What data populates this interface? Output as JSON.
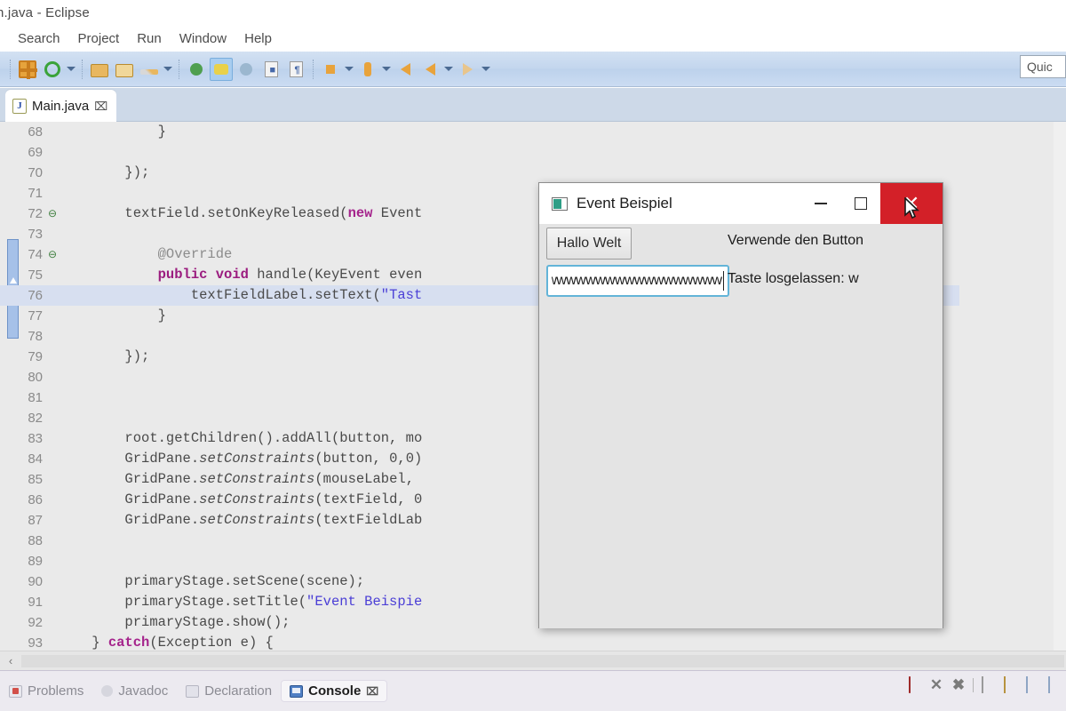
{
  "window": {
    "title": "n.java - Eclipse"
  },
  "menu": {
    "items": [
      "Search",
      "Project",
      "Run",
      "Window",
      "Help"
    ]
  },
  "toolbar": {
    "quick_access_placeholder": "Quick Access",
    "quick_access_value": "Quic"
  },
  "editor_tab": {
    "label": "Main.java",
    "icon": "J",
    "close": "⌧"
  },
  "code": {
    "cut_line": "",
    "lines": [
      {
        "n": "68",
        "fold": false,
        "hl": false,
        "segments": [
          {
            "t": "            }",
            "c": "pl"
          }
        ]
      },
      {
        "n": "69",
        "fold": false,
        "hl": false,
        "segments": [
          {
            "t": "",
            "c": "pl"
          }
        ]
      },
      {
        "n": "70",
        "fold": false,
        "hl": false,
        "segments": [
          {
            "t": "        });",
            "c": "pl"
          }
        ]
      },
      {
        "n": "71",
        "fold": false,
        "hl": false,
        "segments": [
          {
            "t": "",
            "c": "pl"
          }
        ]
      },
      {
        "n": "72",
        "fold": true,
        "hl": false,
        "segments": [
          {
            "t": "        textField.setOnKeyReleased(",
            "c": "pl"
          },
          {
            "t": "new",
            "c": "k"
          },
          {
            "t": " Event",
            "c": "pl"
          }
        ]
      },
      {
        "n": "73",
        "fold": false,
        "hl": false,
        "segments": [
          {
            "t": "",
            "c": "pl"
          }
        ]
      },
      {
        "n": "74",
        "fold": true,
        "hl": false,
        "segments": [
          {
            "t": "            ",
            "c": "pl"
          },
          {
            "t": "@Override",
            "c": "ann"
          }
        ]
      },
      {
        "n": "75",
        "fold": false,
        "hl": false,
        "segments": [
          {
            "t": "            ",
            "c": "pl"
          },
          {
            "t": "public void",
            "c": "kb"
          },
          {
            "t": " handle(KeyEvent even",
            "c": "pl"
          }
        ]
      },
      {
        "n": "76",
        "fold": false,
        "hl": true,
        "segments": [
          {
            "t": "                textFieldLabel.setText(",
            "c": "pl"
          },
          {
            "t": "\"Tast",
            "c": "str"
          }
        ]
      },
      {
        "n": "77",
        "fold": false,
        "hl": false,
        "segments": [
          {
            "t": "            }",
            "c": "pl"
          }
        ]
      },
      {
        "n": "78",
        "fold": false,
        "hl": false,
        "segments": [
          {
            "t": "",
            "c": "pl"
          }
        ]
      },
      {
        "n": "79",
        "fold": false,
        "hl": false,
        "segments": [
          {
            "t": "        });",
            "c": "pl"
          }
        ]
      },
      {
        "n": "80",
        "fold": false,
        "hl": false,
        "segments": [
          {
            "t": "",
            "c": "pl"
          }
        ]
      },
      {
        "n": "81",
        "fold": false,
        "hl": false,
        "segments": [
          {
            "t": "",
            "c": "pl"
          }
        ]
      },
      {
        "n": "82",
        "fold": false,
        "hl": false,
        "segments": [
          {
            "t": "",
            "c": "pl"
          }
        ]
      },
      {
        "n": "83",
        "fold": false,
        "hl": false,
        "segments": [
          {
            "t": "        root.getChildren().addAll(button, mo",
            "c": "pl"
          }
        ]
      },
      {
        "n": "84",
        "fold": false,
        "hl": false,
        "segments": [
          {
            "t": "        GridPane.",
            "c": "pl"
          },
          {
            "t": "setConstraints",
            "c": "it"
          },
          {
            "t": "(button, 0,0)",
            "c": "pl"
          }
        ]
      },
      {
        "n": "85",
        "fold": false,
        "hl": false,
        "segments": [
          {
            "t": "        GridPane.",
            "c": "pl"
          },
          {
            "t": "setConstraints",
            "c": "it"
          },
          {
            "t": "(mouseLabel,",
            "c": "pl"
          }
        ]
      },
      {
        "n": "86",
        "fold": false,
        "hl": false,
        "segments": [
          {
            "t": "        GridPane.",
            "c": "pl"
          },
          {
            "t": "setConstraints",
            "c": "it"
          },
          {
            "t": "(textField, 0",
            "c": "pl"
          }
        ]
      },
      {
        "n": "87",
        "fold": false,
        "hl": false,
        "segments": [
          {
            "t": "        GridPane.",
            "c": "pl"
          },
          {
            "t": "setConstraints",
            "c": "it"
          },
          {
            "t": "(textFieldLab",
            "c": "pl"
          }
        ]
      },
      {
        "n": "88",
        "fold": false,
        "hl": false,
        "segments": [
          {
            "t": "",
            "c": "pl"
          }
        ]
      },
      {
        "n": "89",
        "fold": false,
        "hl": false,
        "segments": [
          {
            "t": "",
            "c": "pl"
          }
        ]
      },
      {
        "n": "90",
        "fold": false,
        "hl": false,
        "segments": [
          {
            "t": "        primaryStage.setScene(scene);",
            "c": "pl"
          }
        ]
      },
      {
        "n": "91",
        "fold": false,
        "hl": false,
        "segments": [
          {
            "t": "        primaryStage.setTitle(",
            "c": "pl"
          },
          {
            "t": "\"Event Beispie",
            "c": "str"
          }
        ]
      },
      {
        "n": "92",
        "fold": false,
        "hl": false,
        "segments": [
          {
            "t": "        primaryStage.show();",
            "c": "pl"
          }
        ]
      },
      {
        "n": "93",
        "fold": false,
        "hl": false,
        "segments": [
          {
            "t": "    } ",
            "c": "pl"
          },
          {
            "t": "catch",
            "c": "k"
          },
          {
            "t": "(Exception e) {",
            "c": "pl"
          }
        ]
      }
    ]
  },
  "fx_dialog": {
    "title": "Event Beispiel",
    "minimize_label": "—",
    "maximize_label": "□",
    "close_label": "✕",
    "button_label": "Hallo Welt",
    "mouse_label": "Verwende den Button",
    "textfield_value": "wwwwwwwwwwwwwwwwww",
    "key_label": "Taste losgelassen: w"
  },
  "bottom_panel": {
    "tabs": [
      {
        "label": "Problems",
        "icon": "problems-icon",
        "active": false,
        "closable": false
      },
      {
        "label": "Javadoc",
        "icon": "javadoc-icon",
        "active": false,
        "closable": false
      },
      {
        "label": "Declaration",
        "icon": "declaration-icon",
        "active": false,
        "closable": false
      },
      {
        "label": "Console",
        "icon": "console-icon",
        "active": true,
        "closable": true
      }
    ],
    "close_glyph": "⌧"
  },
  "scrollbar": {
    "left_arrow": "‹"
  },
  "colors": {
    "toolbar_blue": "#c3d6ee",
    "tabbar_blue": "#cdd9e8",
    "close_red": "#d32028",
    "focus_blue": "#63b4d8",
    "highlight_line": "#d7dff0",
    "keyword_magenta": "#a5248c",
    "string_blue": "#4b3fd6",
    "fx_icon_green": "#2e9e86"
  }
}
